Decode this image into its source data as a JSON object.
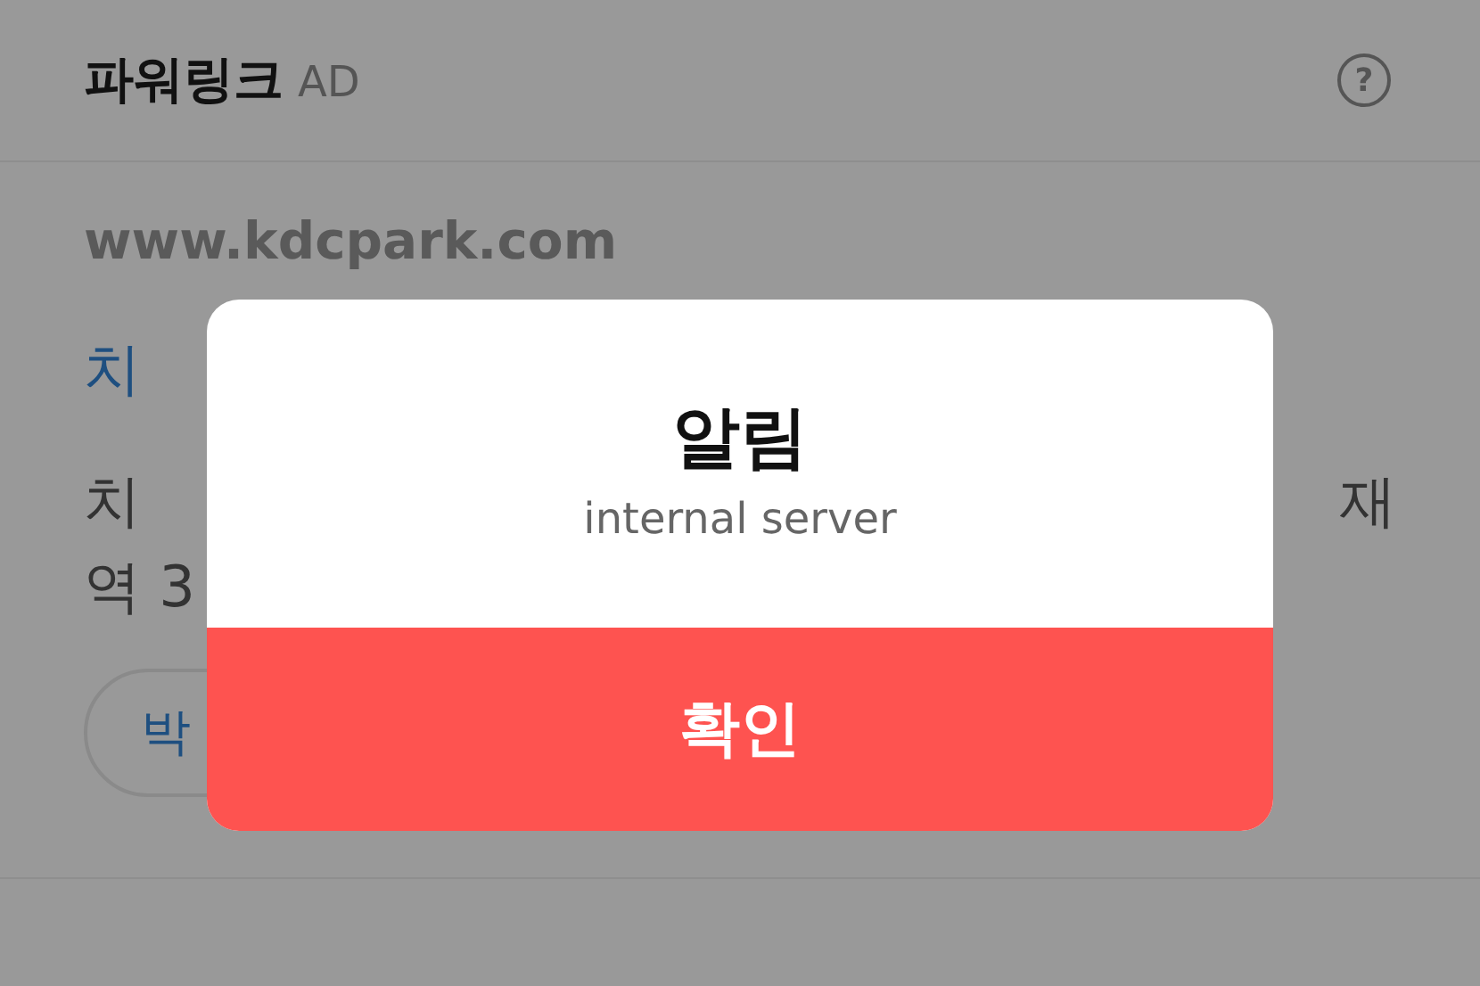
{
  "header": {
    "title": "파워링크",
    "badge": "AD",
    "help": "?"
  },
  "ad": {
    "url": "www.kdcpark.com",
    "title": "치",
    "description_left": "치",
    "description_right": "재",
    "description_line_2": "역 3",
    "chip": "박"
  },
  "dialog": {
    "title": "알림",
    "message": "internal server",
    "button": "확인"
  }
}
